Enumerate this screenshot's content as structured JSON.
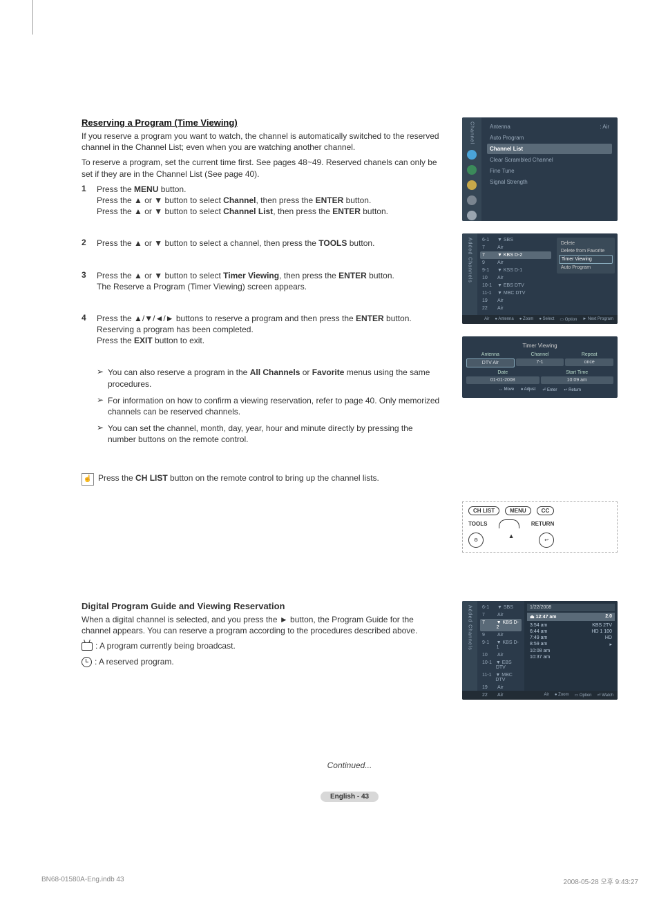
{
  "section1": {
    "title": "Reserving a Program (Time Viewing)",
    "intro1": "If you reserve a program you want to watch, the channel is automatically switched to the reserved channel in the Channel List; even when you are watching another channel.",
    "intro2": "To reserve a program, set the current time first. See pages 48~49. Reserved chanels can only be set if they are in the Channel List (See page 40).",
    "steps": [
      {
        "num": "1",
        "lines": [
          "Press the <b>MENU</b> button.",
          "Press the ▲ or ▼ button to select <b>Channel</b>, then press the <b>ENTER</b> button.",
          "Press the ▲ or ▼ button to select <b>Channel List</b>, then press the <b>ENTER</b> button."
        ]
      },
      {
        "num": "2",
        "lines": [
          "Press the ▲ or ▼ button to select a channel, then press the <b>TOOLS</b> button."
        ]
      },
      {
        "num": "3",
        "lines": [
          "Press the ▲ or ▼ button to select <b>Timer Viewing</b>, then press the <b>ENTER</b> button.",
          "The Reserve a Program (Timer Viewing) screen appears."
        ]
      },
      {
        "num": "4",
        "lines": [
          "Press the ▲/▼/◄/► buttons to reserve a program and then press the <b>ENTER</b> button.",
          "Reserving a program has been completed.",
          "Press the <b>EXIT</b> button to exit."
        ],
        "subnotes": [
          "You can also reserve a program in the <b>All Channels</b> or <b>Favorite</b> menus using the same procedures.",
          "For information on how to confirm a viewing reservation, refer to page 40. Only memorized channels can be reserved channels.",
          "You can set the channel, month, day, year, hour and minute directly by pressing the number buttons on the remote control."
        ]
      }
    ],
    "note": "Press the <b>CH LIST</b> button on the remote control to bring up the channel lists."
  },
  "section2": {
    "title": "Digital Program Guide and Viewing Reservation",
    "intro": "When a digital channel is selected, and you press the ► button, the Program Guide for the channel appears. You can reserve a program according to the procedures described above.",
    "legend1": ": A program currently being broadcast.",
    "legend2": ": A reserved program."
  },
  "osd_menu": {
    "side_label": "Channel",
    "rows": [
      {
        "label": "Antenna",
        "value": ": Air"
      },
      {
        "label": "Auto Program",
        "value": ""
      },
      {
        "label": "Channel List",
        "value": "",
        "selected": true
      },
      {
        "label": "Clear Scrambled Channel",
        "value": ""
      },
      {
        "label": "Fine Tune",
        "value": ""
      },
      {
        "label": "Signal Strength",
        "value": ""
      }
    ]
  },
  "osd_chlist": {
    "side_label": "Added Channels",
    "channels": [
      {
        "num": "6-1",
        "name": "▼ SBS"
      },
      {
        "num": "7",
        "name": "Air"
      },
      {
        "num": "7",
        "name": "▼ KBS D-2",
        "selected": true
      },
      {
        "num": "9",
        "name": "Air"
      },
      {
        "num": "9-1",
        "name": "▼ KSS D-1"
      },
      {
        "num": "10",
        "name": "Air"
      },
      {
        "num": "10-1",
        "name": "▼ EBS DTV"
      },
      {
        "num": "11-1",
        "name": "▼ MBC DTV"
      },
      {
        "num": "19",
        "name": "Air"
      },
      {
        "num": "22",
        "name": "Air"
      }
    ],
    "options": [
      {
        "label": "Delete"
      },
      {
        "label": "Delete from Favorite"
      },
      {
        "label": "Timer Viewing",
        "selected": true
      },
      {
        "label": "Auto Program"
      }
    ],
    "footer": [
      "Air",
      "● Antenna",
      "● Zoom",
      "● Select",
      "▭ Option",
      "► Next Program"
    ]
  },
  "osd_timer": {
    "title": "Timer Viewing",
    "cells_top": [
      {
        "label": "Antenna",
        "value": "DTV Air",
        "selected": true
      },
      {
        "label": "Channel",
        "value": "7-1"
      },
      {
        "label": "Repeat",
        "value": "once"
      }
    ],
    "cells_bottom": [
      {
        "label": "Date",
        "value": "01-01-2008"
      },
      {
        "label": "Start Time",
        "value": "10:09 am"
      }
    ],
    "foot": [
      "↔ Move",
      "♦ Adjust",
      "⏎ Enter",
      "↩ Return"
    ]
  },
  "remote": {
    "btns": [
      "CH LIST",
      "MENU",
      "CC",
      "TOOLS",
      "RETURN"
    ]
  },
  "osd_guide": {
    "side_label": "Added Channels",
    "channels": [
      {
        "num": "6-1",
        "name": "▼ SBS"
      },
      {
        "num": "7",
        "name": "Air"
      },
      {
        "num": "7",
        "name": "▼ KBS D-2",
        "selected": true
      },
      {
        "num": "9",
        "name": "Air"
      },
      {
        "num": "9-1",
        "name": "▼ KBS D-1"
      },
      {
        "num": "10",
        "name": "Air"
      },
      {
        "num": "10-1",
        "name": "▼ EBS DTV"
      },
      {
        "num": "11-1",
        "name": "▼ MBC DTV"
      },
      {
        "num": "19",
        "name": "Air"
      },
      {
        "num": "22",
        "name": "Air"
      }
    ],
    "date": "1/22/2008",
    "head_time": "⏏ 12:47 am",
    "head_val": "2.0",
    "progs": [
      {
        "time": "3:54 am",
        "title": "KBS 2TV"
      },
      {
        "time": "6:44 am",
        "title": "HD 1 100"
      },
      {
        "time": "7:49 am",
        "title": "HD"
      },
      {
        "time": "8:59 am",
        "title": "▸"
      },
      {
        "time": "10:08 am",
        "title": ""
      },
      {
        "time": "10:37 am",
        "title": ""
      }
    ],
    "footer": [
      "Air",
      "● Zoom",
      "▭ Option",
      "⏎ Watch"
    ]
  },
  "continued": "Continued...",
  "page_label": "English - 43",
  "footer_left": "BN68-01580A-Eng.indb   43",
  "footer_right": "2008-05-28   오후 9:43:27"
}
